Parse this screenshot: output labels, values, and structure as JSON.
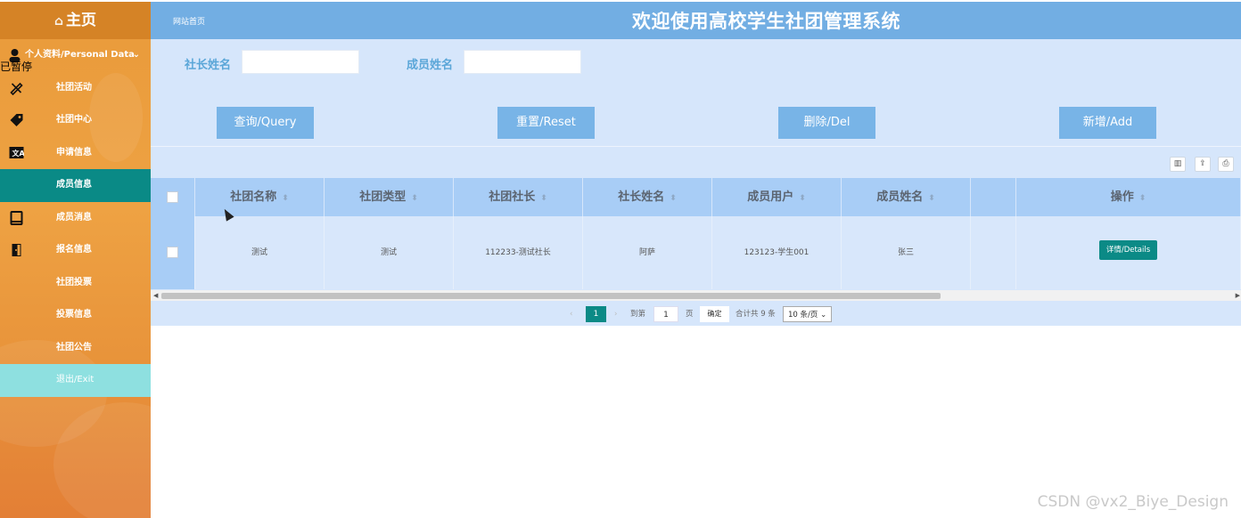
{
  "sidebar": {
    "home_label": "主页",
    "items": [
      {
        "label": "个人资料/Personal Data",
        "icon": "person-icon"
      },
      {
        "label": "社团活动",
        "icon": "pencil-ruler-icon"
      },
      {
        "label": "社团中心",
        "icon": "tags-icon"
      },
      {
        "label": "申请信息",
        "icon": "translate-icon"
      },
      {
        "label": "成员信息",
        "icon": "none"
      },
      {
        "label": "成员消息",
        "icon": "book-icon"
      },
      {
        "label": "报名信息",
        "icon": "door-icon"
      },
      {
        "label": "社团投票",
        "icon": "none"
      },
      {
        "label": "投票信息",
        "icon": "none"
      },
      {
        "label": "社团公告",
        "icon": "none"
      },
      {
        "label": "退出/Exit",
        "icon": "none"
      }
    ],
    "paused_overlay": "已暂停",
    "active_index": 4
  },
  "header": {
    "breadcrumb": "网站首页",
    "title": "欢迎使用高校学生社团管理系统"
  },
  "search": {
    "leader_name_label": "社长姓名",
    "leader_name_value": "",
    "member_name_label": "成员姓名",
    "member_name_value": ""
  },
  "buttons": {
    "query": "查询/Query",
    "reset": "重置/Reset",
    "delete": "删除/Del",
    "add": "新增/Add"
  },
  "table": {
    "columns": [
      "社团名称",
      "社团类型",
      "社团社长",
      "社长姓名",
      "成员用户",
      "成员姓名",
      "",
      "操作"
    ],
    "rows": [
      [
        "测试",
        "测试",
        "112233-测试社长",
        "阿萨",
        "123123-学生001",
        "张三",
        "",
        "详情/Details"
      ]
    ]
  },
  "pagination": {
    "current_page": "1",
    "goto_prefix": "到第",
    "goto_value": "1",
    "goto_suffix": "页",
    "confirm": "确定",
    "total": "合计共 9 条",
    "page_size": "10 条/页"
  },
  "watermark": "CSDN @vx2_Biye_Design",
  "colors": {
    "sidebar": "#eea243",
    "header": "#72aee3",
    "content_bg": "#d6e6fb",
    "active": "#0a8a86",
    "button": "#78b4e7"
  }
}
